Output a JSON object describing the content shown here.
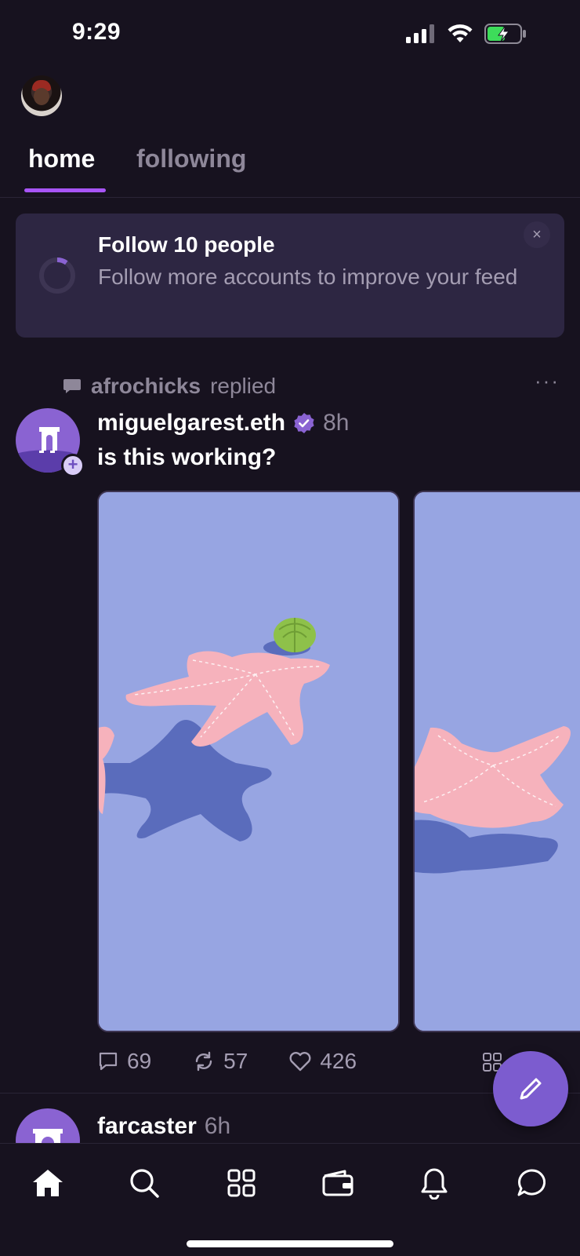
{
  "status_bar": {
    "time": "9:29"
  },
  "tabs": [
    {
      "label": "home",
      "active": true
    },
    {
      "label": "following",
      "active": false
    }
  ],
  "follow_card": {
    "title": "Follow 10 people",
    "subtitle": "Follow more accounts to improve your feed",
    "close_glyph": "×",
    "progress_fraction": 0.1
  },
  "post": {
    "reply_user": "afrochicks",
    "reply_action": "replied",
    "more": "···",
    "author": "miguelgarest.eth",
    "time": "8h",
    "text": "is this working?",
    "counts": {
      "comments": "69",
      "recasts": "57",
      "likes": "426"
    }
  },
  "next_post": {
    "author": "farcaster",
    "time": "6h"
  },
  "bottom_nav": [
    {
      "name": "home",
      "icon": "home-icon"
    },
    {
      "name": "search",
      "icon": "search-icon"
    },
    {
      "name": "apps",
      "icon": "grid-icon"
    },
    {
      "name": "wallet",
      "icon": "wallet-icon"
    },
    {
      "name": "notifications",
      "icon": "bell-icon"
    },
    {
      "name": "messages",
      "icon": "chat-icon"
    }
  ],
  "colors": {
    "background": "#17121F",
    "accent": "#A855F7",
    "card": "#2D2642",
    "fab": "#7C5CCF"
  }
}
